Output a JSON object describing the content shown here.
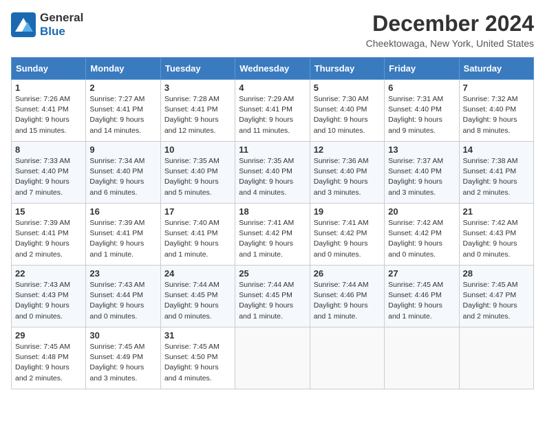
{
  "header": {
    "logo_line1": "General",
    "logo_line2": "Blue",
    "month": "December 2024",
    "location": "Cheektowaga, New York, United States"
  },
  "weekdays": [
    "Sunday",
    "Monday",
    "Tuesday",
    "Wednesday",
    "Thursday",
    "Friday",
    "Saturday"
  ],
  "weeks": [
    [
      {
        "day": "1",
        "sunrise": "7:26 AM",
        "sunset": "4:41 PM",
        "daylight": "9 hours and 15 minutes."
      },
      {
        "day": "2",
        "sunrise": "7:27 AM",
        "sunset": "4:41 PM",
        "daylight": "9 hours and 14 minutes."
      },
      {
        "day": "3",
        "sunrise": "7:28 AM",
        "sunset": "4:41 PM",
        "daylight": "9 hours and 12 minutes."
      },
      {
        "day": "4",
        "sunrise": "7:29 AM",
        "sunset": "4:41 PM",
        "daylight": "9 hours and 11 minutes."
      },
      {
        "day": "5",
        "sunrise": "7:30 AM",
        "sunset": "4:40 PM",
        "daylight": "9 hours and 10 minutes."
      },
      {
        "day": "6",
        "sunrise": "7:31 AM",
        "sunset": "4:40 PM",
        "daylight": "9 hours and 9 minutes."
      },
      {
        "day": "7",
        "sunrise": "7:32 AM",
        "sunset": "4:40 PM",
        "daylight": "9 hours and 8 minutes."
      }
    ],
    [
      {
        "day": "8",
        "sunrise": "7:33 AM",
        "sunset": "4:40 PM",
        "daylight": "9 hours and 7 minutes."
      },
      {
        "day": "9",
        "sunrise": "7:34 AM",
        "sunset": "4:40 PM",
        "daylight": "9 hours and 6 minutes."
      },
      {
        "day": "10",
        "sunrise": "7:35 AM",
        "sunset": "4:40 PM",
        "daylight": "9 hours and 5 minutes."
      },
      {
        "day": "11",
        "sunrise": "7:35 AM",
        "sunset": "4:40 PM",
        "daylight": "9 hours and 4 minutes."
      },
      {
        "day": "12",
        "sunrise": "7:36 AM",
        "sunset": "4:40 PM",
        "daylight": "9 hours and 3 minutes."
      },
      {
        "day": "13",
        "sunrise": "7:37 AM",
        "sunset": "4:40 PM",
        "daylight": "9 hours and 3 minutes."
      },
      {
        "day": "14",
        "sunrise": "7:38 AM",
        "sunset": "4:41 PM",
        "daylight": "9 hours and 2 minutes."
      }
    ],
    [
      {
        "day": "15",
        "sunrise": "7:39 AM",
        "sunset": "4:41 PM",
        "daylight": "9 hours and 2 minutes."
      },
      {
        "day": "16",
        "sunrise": "7:39 AM",
        "sunset": "4:41 PM",
        "daylight": "9 hours and 1 minute."
      },
      {
        "day": "17",
        "sunrise": "7:40 AM",
        "sunset": "4:41 PM",
        "daylight": "9 hours and 1 minute."
      },
      {
        "day": "18",
        "sunrise": "7:41 AM",
        "sunset": "4:42 PM",
        "daylight": "9 hours and 1 minute."
      },
      {
        "day": "19",
        "sunrise": "7:41 AM",
        "sunset": "4:42 PM",
        "daylight": "9 hours and 0 minutes."
      },
      {
        "day": "20",
        "sunrise": "7:42 AM",
        "sunset": "4:42 PM",
        "daylight": "9 hours and 0 minutes."
      },
      {
        "day": "21",
        "sunrise": "7:42 AM",
        "sunset": "4:43 PM",
        "daylight": "9 hours and 0 minutes."
      }
    ],
    [
      {
        "day": "22",
        "sunrise": "7:43 AM",
        "sunset": "4:43 PM",
        "daylight": "9 hours and 0 minutes."
      },
      {
        "day": "23",
        "sunrise": "7:43 AM",
        "sunset": "4:44 PM",
        "daylight": "9 hours and 0 minutes."
      },
      {
        "day": "24",
        "sunrise": "7:44 AM",
        "sunset": "4:45 PM",
        "daylight": "9 hours and 0 minutes."
      },
      {
        "day": "25",
        "sunrise": "7:44 AM",
        "sunset": "4:45 PM",
        "daylight": "9 hours and 1 minute."
      },
      {
        "day": "26",
        "sunrise": "7:44 AM",
        "sunset": "4:46 PM",
        "daylight": "9 hours and 1 minute."
      },
      {
        "day": "27",
        "sunrise": "7:45 AM",
        "sunset": "4:46 PM",
        "daylight": "9 hours and 1 minute."
      },
      {
        "day": "28",
        "sunrise": "7:45 AM",
        "sunset": "4:47 PM",
        "daylight": "9 hours and 2 minutes."
      }
    ],
    [
      {
        "day": "29",
        "sunrise": "7:45 AM",
        "sunset": "4:48 PM",
        "daylight": "9 hours and 2 minutes."
      },
      {
        "day": "30",
        "sunrise": "7:45 AM",
        "sunset": "4:49 PM",
        "daylight": "9 hours and 3 minutes."
      },
      {
        "day": "31",
        "sunrise": "7:45 AM",
        "sunset": "4:50 PM",
        "daylight": "9 hours and 4 minutes."
      },
      null,
      null,
      null,
      null
    ]
  ],
  "labels": {
    "sunrise": "Sunrise:",
    "sunset": "Sunset:",
    "daylight": "Daylight:"
  }
}
